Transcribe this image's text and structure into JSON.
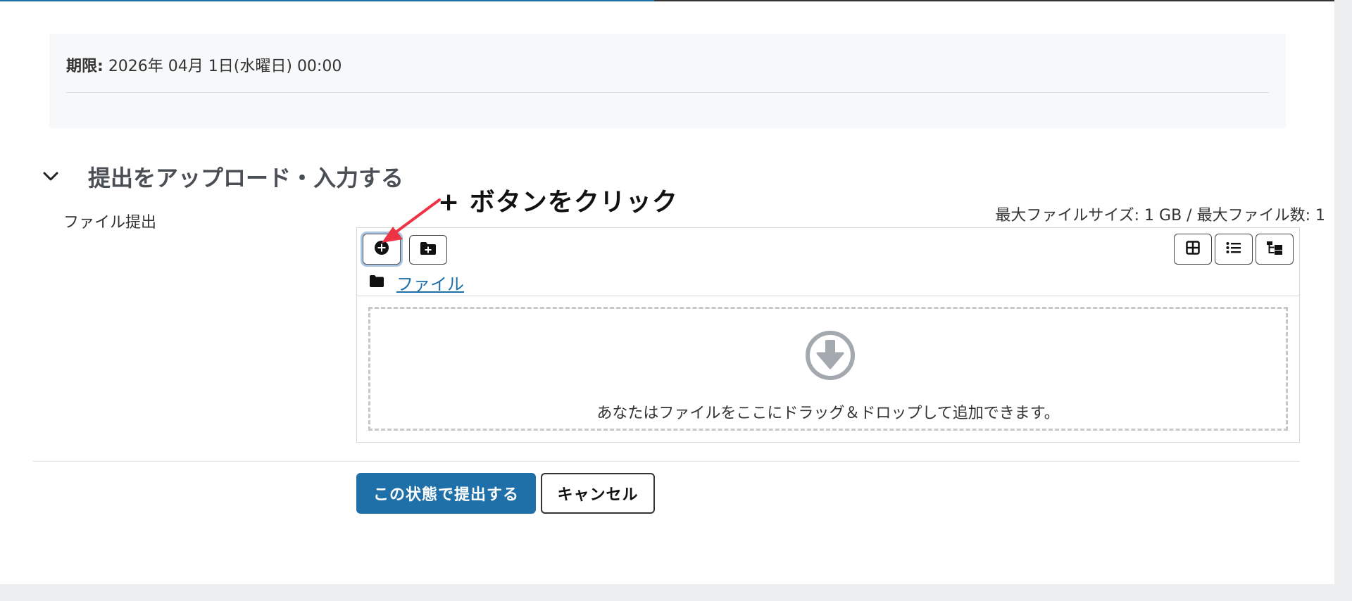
{
  "due": {
    "label": "期限:",
    "value": "2026年 04月 1日(水曜日) 00:00"
  },
  "section": {
    "toggle_icon": "chevron-down-icon",
    "title": "提出をアップロード・入力する"
  },
  "annotation": {
    "text": "+ ボタンをクリック",
    "arrow_color": "#ee3344"
  },
  "field": {
    "label": "ファイル提出"
  },
  "limits": {
    "text": "最大ファイルサイズ: 1 GB / 最大ファイル数: 1"
  },
  "filepicker": {
    "toolbar_left": [
      {
        "icon": "add-file-icon"
      },
      {
        "icon": "create-folder-icon"
      }
    ],
    "toolbar_right": [
      {
        "icon": "grid-view-icon"
      },
      {
        "icon": "list-view-icon"
      },
      {
        "icon": "tree-view-icon"
      }
    ],
    "path": {
      "icon": "folder-icon",
      "label": "ファイル"
    },
    "dropzone": {
      "icon": "download-arrow-icon",
      "text": "あなたはファイルをここにドラッグ＆ドロップして追加できます。"
    }
  },
  "actions": {
    "submit_label": "この状態で提出する",
    "cancel_label": "キャンセル"
  },
  "colors": {
    "primary": "#1f6fa8",
    "link": "#1f6fa8",
    "annotation_arrow": "#ee3344"
  },
  "progress": {
    "fraction": 0.49
  }
}
